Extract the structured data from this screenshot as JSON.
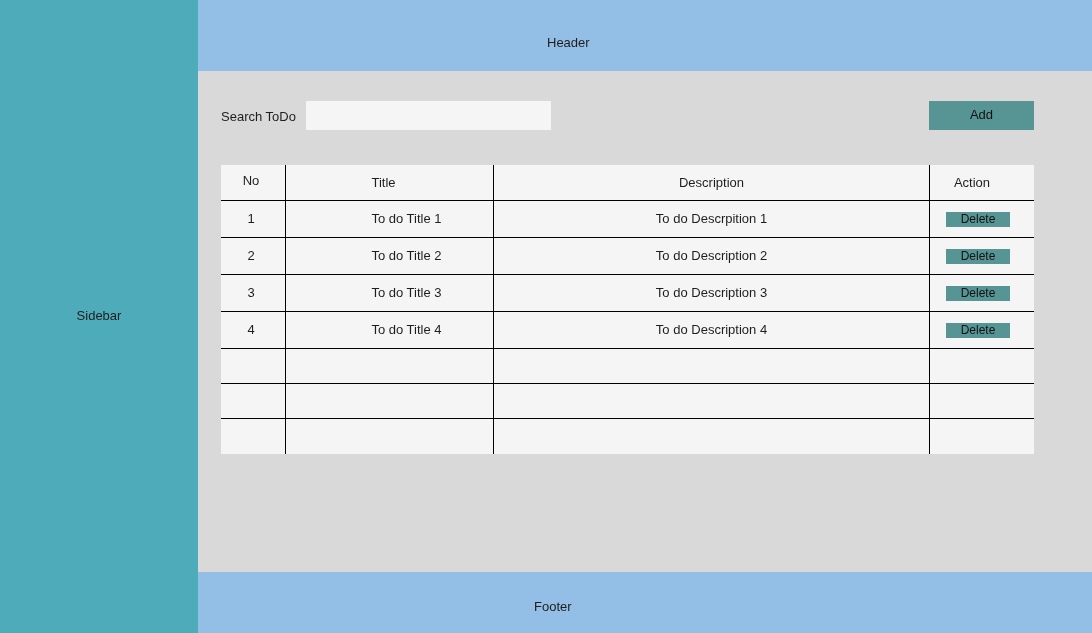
{
  "sidebar": {
    "label": "Sidebar"
  },
  "header": {
    "title": "Header"
  },
  "search": {
    "label": "Search ToDo"
  },
  "add_button": {
    "label": "Add"
  },
  "table": {
    "columns": [
      "No",
      "Title",
      "Description",
      "Action"
    ],
    "rows": [
      {
        "kind": "todo",
        "no": "1",
        "title": "To do Title 1",
        "description": "To do Descrpition 1",
        "action": "Delete"
      },
      {
        "kind": "todo",
        "no": "2",
        "title": "To do Title 2",
        "description": "To do Description 2",
        "action": "Delete"
      },
      {
        "kind": "todo",
        "no": "3",
        "title": "To do Title 3",
        "description": "To do Description 3",
        "action": "Delete"
      },
      {
        "kind": "todo",
        "no": "4",
        "title": "To do Title 4",
        "description": "To do Description 4",
        "action": "Delete"
      },
      {
        "kind": "blank"
      },
      {
        "kind": "blank"
      },
      {
        "kind": "blank"
      }
    ]
  },
  "footer": {
    "text": "Footer"
  }
}
